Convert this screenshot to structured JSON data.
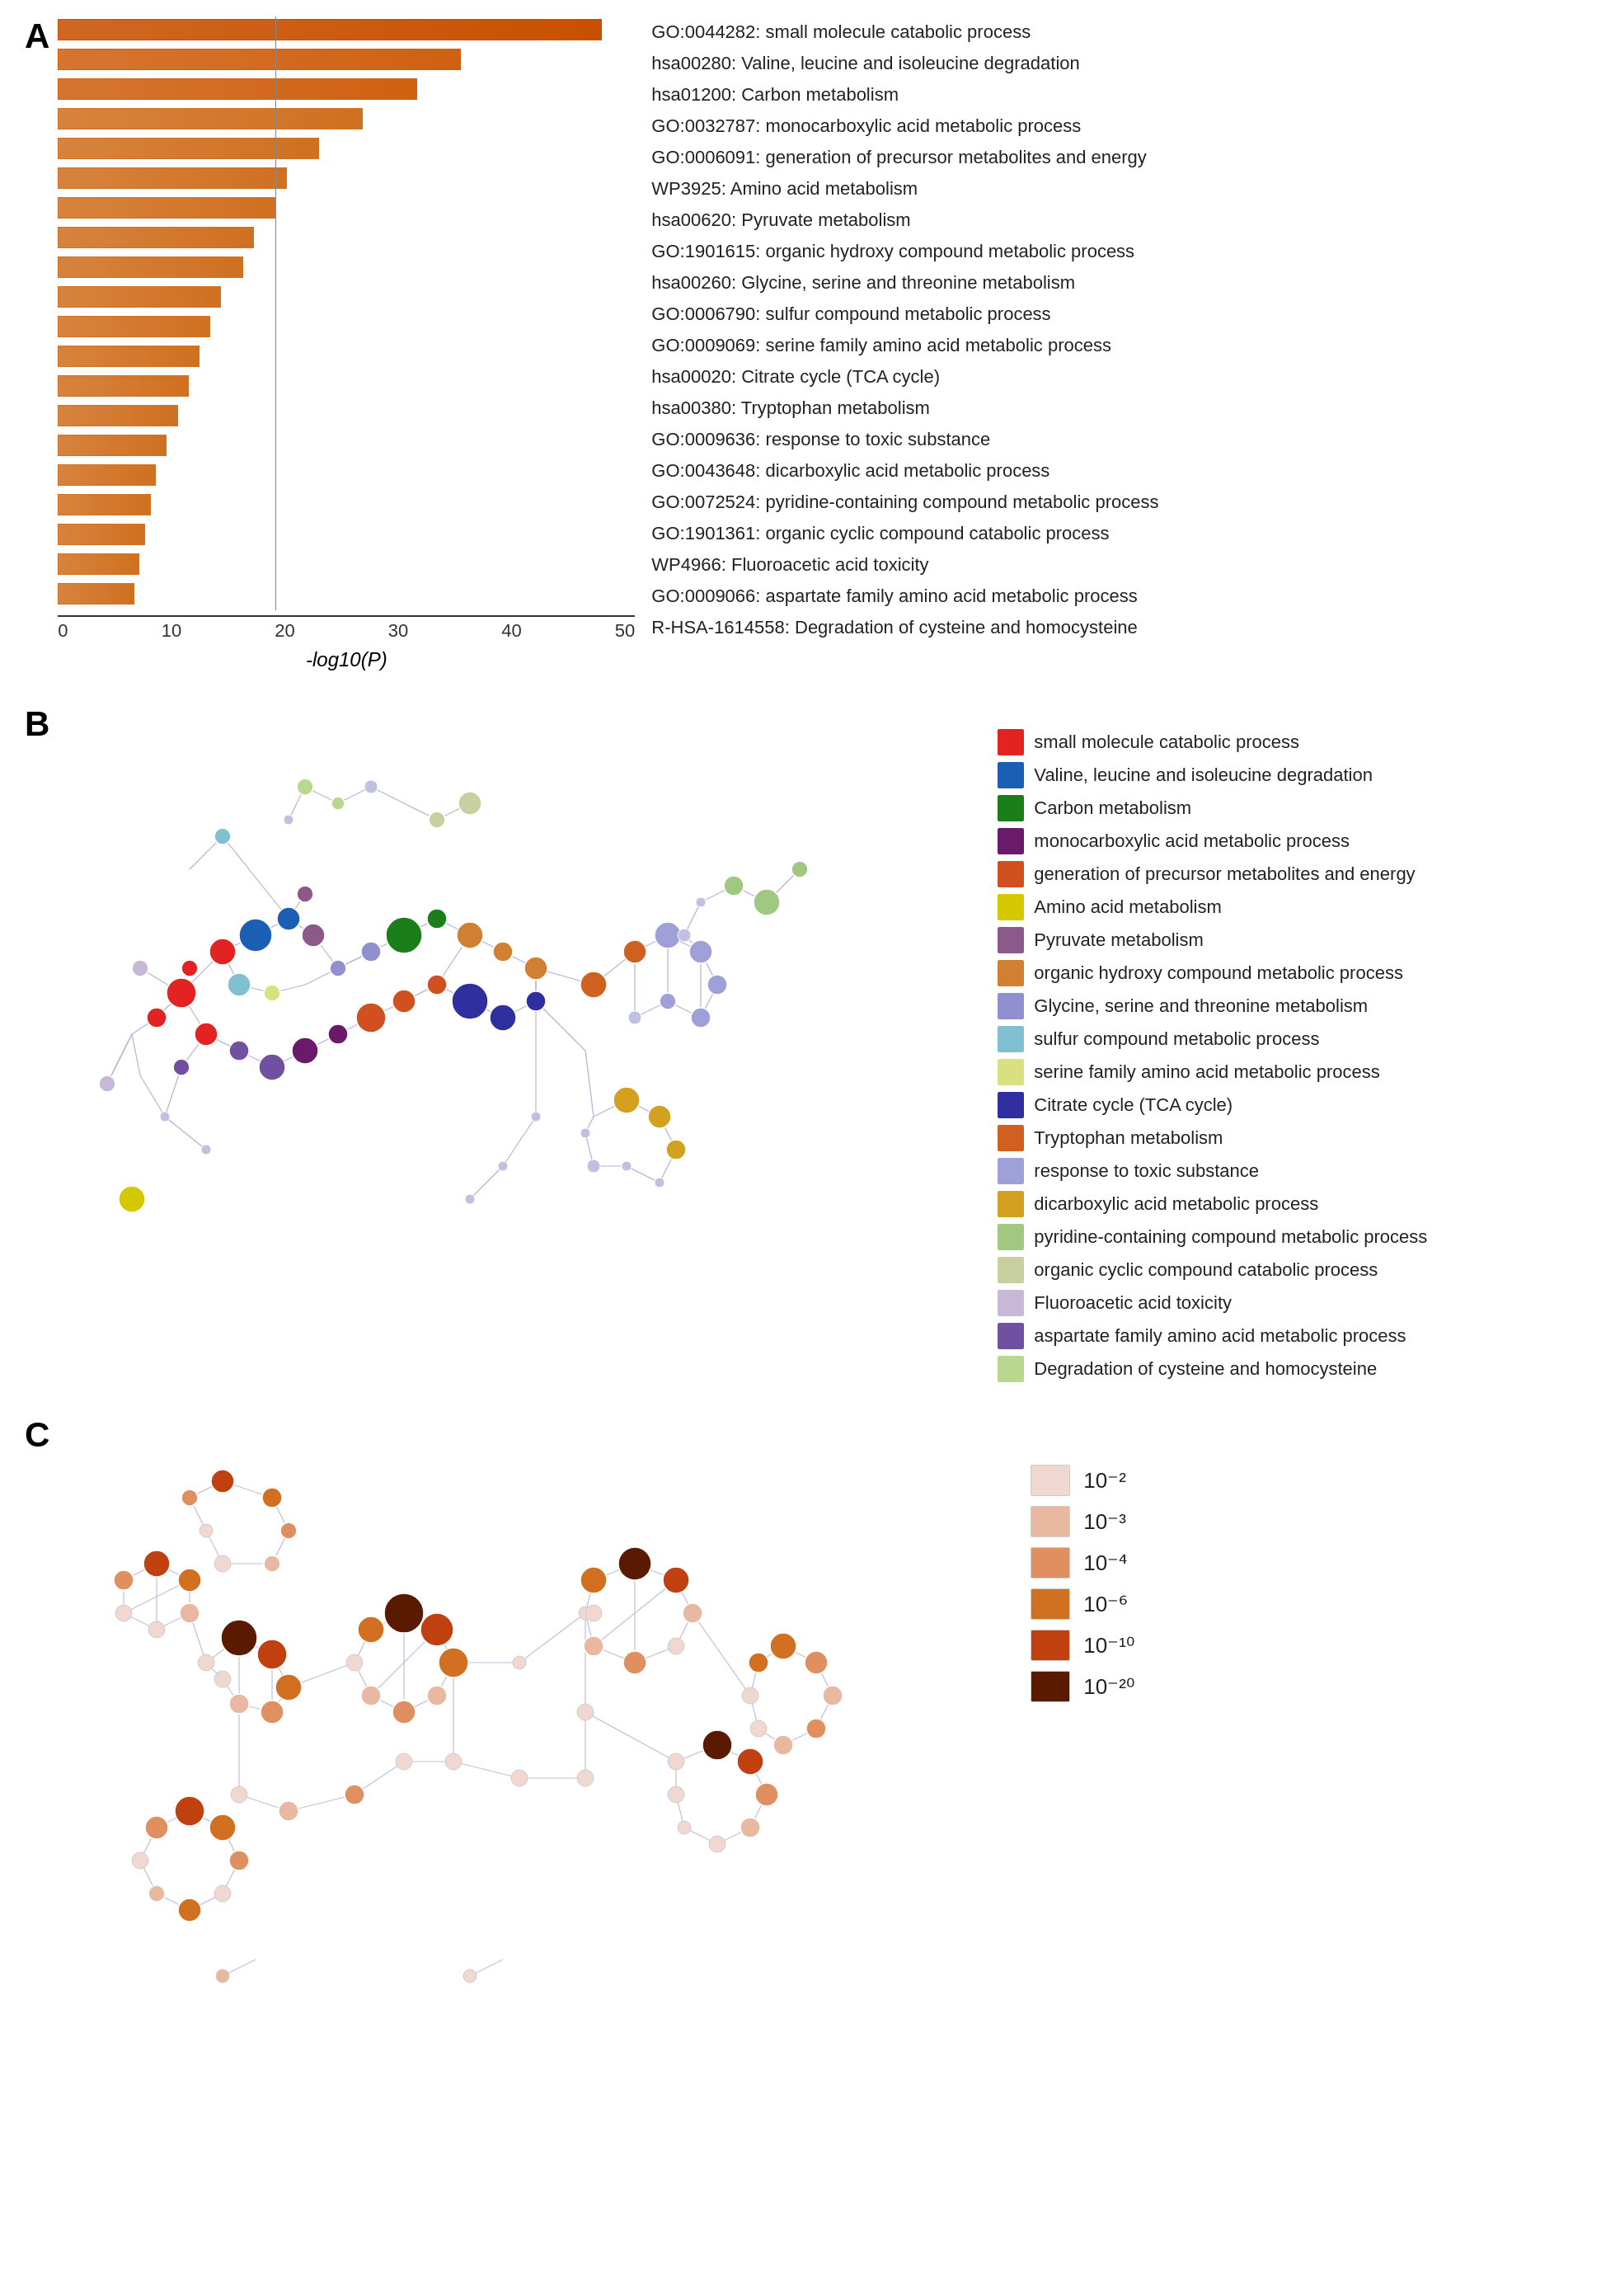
{
  "panelA": {
    "label": "A",
    "bars": [
      {
        "label": "GO:0044282: small molecule catabolic process",
        "value": 50,
        "color": "#c85000"
      },
      {
        "label": "hsa00280: Valine, leucine and isoleucine degradation",
        "value": 37,
        "color": "#d06010"
      },
      {
        "label": "hsa01200: Carbon metabolism",
        "value": 33,
        "color": "#d06010"
      },
      {
        "label": "GO:0032787: monocarboxylic acid metabolic process",
        "value": 28,
        "color": "#d07020"
      },
      {
        "label": "GO:0006091: generation of precursor metabolites and energy",
        "value": 24,
        "color": "#d07020"
      },
      {
        "label": "WP3925: Amino acid metabolism",
        "value": 21,
        "color": "#d07020"
      },
      {
        "label": "hsa00620: Pyruvate metabolism",
        "value": 20,
        "color": "#d07020"
      },
      {
        "label": "GO:1901615: organic hydroxy compound metabolic process",
        "value": 18,
        "color": "#d07020"
      },
      {
        "label": "hsa00260: Glycine, serine and threonine metabolism",
        "value": 17,
        "color": "#d07020"
      },
      {
        "label": "GO:0006790: sulfur compound metabolic process",
        "value": 15,
        "color": "#d07020"
      },
      {
        "label": "GO:0009069: serine family amino acid metabolic process",
        "value": 14,
        "color": "#d07020"
      },
      {
        "label": "hsa00020: Citrate cycle (TCA cycle)",
        "value": 13,
        "color": "#d07020"
      },
      {
        "label": "hsa00380: Tryptophan metabolism",
        "value": 12,
        "color": "#d07020"
      },
      {
        "label": "GO:0009636: response to toxic substance",
        "value": 11,
        "color": "#d07020"
      },
      {
        "label": "GO:0043648: dicarboxylic acid metabolic process",
        "value": 10,
        "color": "#d07020"
      },
      {
        "label": "GO:0072524: pyridine-containing compound metabolic process",
        "value": 9,
        "color": "#d07020"
      },
      {
        "label": "GO:1901361: organic cyclic compound catabolic process",
        "value": 8.5,
        "color": "#d07020"
      },
      {
        "label": "WP4966: Fluoroacetic acid toxicity",
        "value": 8,
        "color": "#d07020"
      },
      {
        "label": "GO:0009066: aspartate family amino acid metabolic process",
        "value": 7.5,
        "color": "#d07020"
      },
      {
        "label": "R-HSA-1614558: Degradation of cysteine and homocysteine",
        "value": 7,
        "color": "#d07020"
      }
    ],
    "xTicks": [
      "0",
      "10",
      "20",
      "30",
      "40",
      "50"
    ],
    "xLabel": "-log10(P)",
    "refLineValue": 20
  },
  "panelB": {
    "label": "B",
    "legendItems": [
      {
        "color": "#e32222",
        "text": "small molecule catabolic process"
      },
      {
        "color": "#1a5fb4",
        "text": "Valine, leucine and isoleucine degradation"
      },
      {
        "color": "#1a7f1a",
        "text": "Carbon metabolism"
      },
      {
        "color": "#6b1a6b",
        "text": "monocarboxylic acid metabolic process"
      },
      {
        "color": "#d05020",
        "text": "generation of precursor metabolites and energy"
      },
      {
        "color": "#d4c800",
        "text": "Amino acid metabolism"
      },
      {
        "color": "#8b5a8b",
        "text": "Pyruvate metabolism"
      },
      {
        "color": "#d08030",
        "text": "organic hydroxy compound metabolic process"
      },
      {
        "color": "#9090d0",
        "text": "Glycine, serine and threonine metabolism"
      },
      {
        "color": "#80c0d0",
        "text": "sulfur compound metabolic process"
      },
      {
        "color": "#d8e080",
        "text": "serine family amino acid metabolic process"
      },
      {
        "color": "#2f2f9f",
        "text": "Citrate cycle (TCA cycle)"
      },
      {
        "color": "#d06020",
        "text": "Tryptophan metabolism"
      },
      {
        "color": "#a0a0d8",
        "text": "response to toxic substance"
      },
      {
        "color": "#d4a020",
        "text": "dicarboxylic acid metabolic process"
      },
      {
        "color": "#a0c880",
        "text": "pyridine-containing compound metabolic process"
      },
      {
        "color": "#c8d0a0",
        "text": "organic cyclic compound catabolic process"
      },
      {
        "color": "#c8b8d8",
        "text": "Fluoroacetic acid toxicity"
      },
      {
        "color": "#7050a0",
        "text": "aspartate family amino acid metabolic process"
      },
      {
        "color": "#b8d890",
        "text": "Degradation of cysteine and homocysteine"
      }
    ]
  },
  "panelC": {
    "label": "C",
    "legendItems": [
      {
        "color": "#f0d8d0",
        "text": "10⁻²"
      },
      {
        "color": "#e8b8a0",
        "text": "10⁻³"
      },
      {
        "color": "#e09060",
        "text": "10⁻⁴"
      },
      {
        "color": "#d07020",
        "text": "10⁻⁶"
      },
      {
        "color": "#c04010",
        "text": "10⁻¹⁰"
      },
      {
        "color": "#5a1a00",
        "text": "10⁻²⁰"
      }
    ]
  }
}
